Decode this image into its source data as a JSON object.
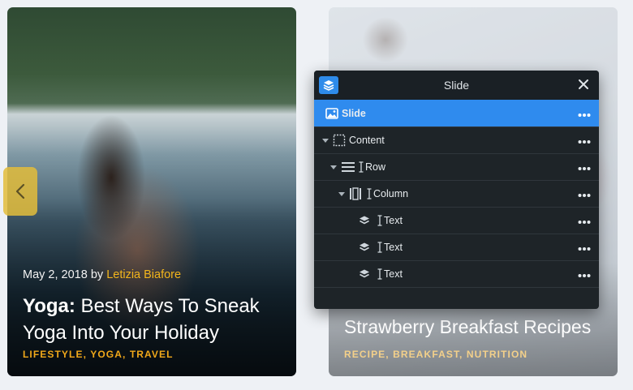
{
  "left_card": {
    "date_prefix": "May 2, 2018 by",
    "author": "Letizia Biafore",
    "title_bold": "Yoga:",
    "title_rest": " Best Ways To Sneak Yoga Into Your Holiday",
    "tags": "LIFESTYLE, YOGA, TRAVEL"
  },
  "right_card": {
    "title": "Strawberry Breakfast Recipes",
    "tags": "RECIPE, BREAKFAST, NUTRITION"
  },
  "panel": {
    "title": "Slide",
    "rows": [
      {
        "label": "Slide",
        "icon": "image-icon"
      },
      {
        "label": "Content",
        "icon": "dashed-box-icon"
      },
      {
        "label": "Row",
        "icon": "row-icon"
      },
      {
        "label": "Column",
        "icon": "column-icon"
      },
      {
        "label": "Text",
        "icon": "layers-icon"
      },
      {
        "label": "Text",
        "icon": "layers-icon"
      },
      {
        "label": "Text",
        "icon": "layers-icon"
      }
    ],
    "more": "•••"
  },
  "colors": {
    "accent": "#2f8bee",
    "author": "#f2b51c",
    "tags": "#f0a81a",
    "arrow_bg": "#e3bd3b"
  }
}
